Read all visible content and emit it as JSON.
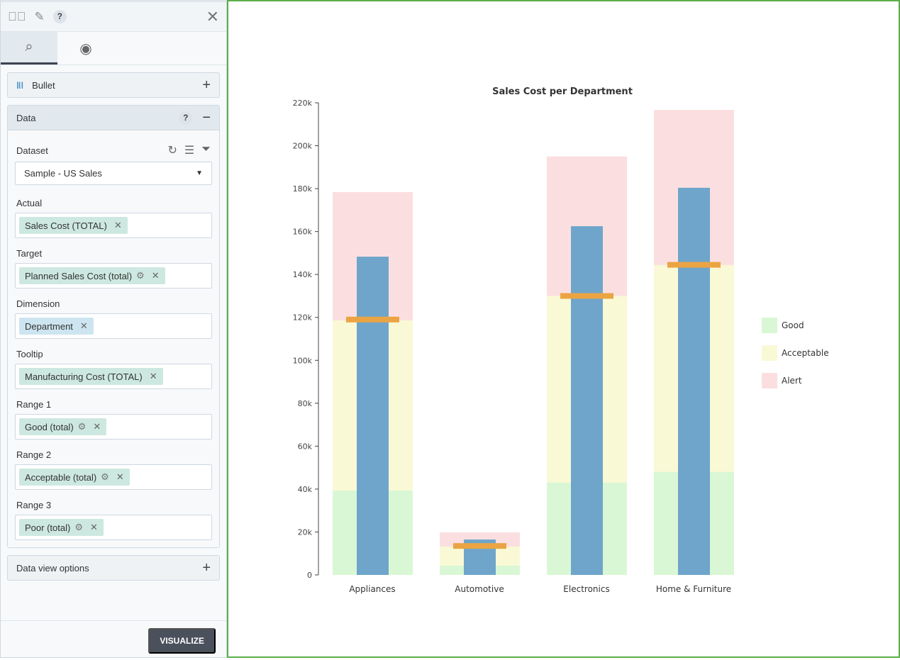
{
  "panel": {
    "help": "?",
    "chart_type": "Bullet",
    "data_section": "Data",
    "dataset_label": "Dataset",
    "dataset_value": "Sample - US Sales",
    "fields": [
      {
        "label": "Actual",
        "chip": "Sales Cost (TOTAL)",
        "gear": false,
        "color": "green"
      },
      {
        "label": "Target",
        "chip": "Planned Sales Cost (total)",
        "gear": true,
        "color": "green"
      },
      {
        "label": "Dimension",
        "chip": "Department",
        "gear": false,
        "color": "blue"
      },
      {
        "label": "Tooltip",
        "chip": "Manufacturing Cost (TOTAL)",
        "gear": false,
        "color": "green"
      },
      {
        "label": "Range 1",
        "chip": "Good (total)",
        "gear": true,
        "color": "green"
      },
      {
        "label": "Range 2",
        "chip": "Acceptable (total)",
        "gear": true,
        "color": "green"
      },
      {
        "label": "Range 3",
        "chip": "Poor (total)",
        "gear": true,
        "color": "green"
      }
    ],
    "data_view_options": "Data view options",
    "visualize": "VISUALIZE"
  },
  "chart_data": {
    "type": "bullet",
    "title": "Sales Cost per Department",
    "categories": [
      "Appliances",
      "Automotive",
      "Electronics",
      "Home & Furniture"
    ],
    "ylim": [
      0,
      220000
    ],
    "yticks": [
      0,
      20000,
      40000,
      60000,
      80000,
      100000,
      120000,
      140000,
      160000,
      180000,
      200000,
      220000
    ],
    "ytick_labels": [
      "0",
      "20k",
      "40k",
      "60k",
      "80k",
      "100k",
      "120k",
      "140k",
      "160k",
      "180k",
      "200k",
      "220k"
    ],
    "ranges": [
      {
        "name": "Good",
        "color": "#d9f7d4",
        "values": [
          39300,
          4300,
          43000,
          48000
        ]
      },
      {
        "name": "Acceptable",
        "color": "#f9f9d6",
        "values": [
          118600,
          13200,
          130000,
          144400
        ]
      },
      {
        "name": "Alert",
        "color": "#fbdfe0",
        "values": [
          178400,
          19800,
          195000,
          216700
        ]
      }
    ],
    "actual": {
      "color": "#6fa5cb",
      "values": [
        148300,
        16500,
        162500,
        180400
      ]
    },
    "target": {
      "color": "#eba443",
      "values": [
        119000,
        13500,
        130000,
        144500
      ]
    },
    "legend_position": "right"
  }
}
